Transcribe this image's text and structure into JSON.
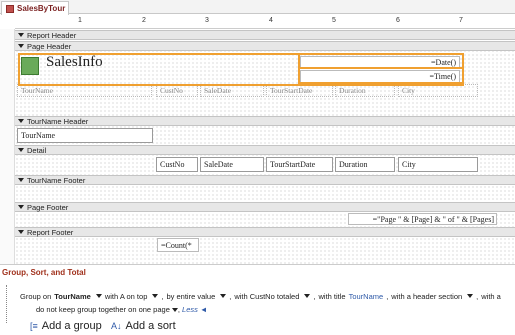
{
  "tab": {
    "title": "SalesByTour"
  },
  "ruler": {
    "marks": [
      "1",
      "2",
      "3",
      "4",
      "5",
      "6",
      "7"
    ]
  },
  "sections": {
    "report_header": "Report Header",
    "page_header": "Page Header",
    "group_header": "TourName Header",
    "detail": "Detail",
    "group_footer": "TourName Footer",
    "page_footer": "Page Footer",
    "report_footer": "Report Footer"
  },
  "page_header": {
    "title": "SalesInfo",
    "date_expr": "=Date()",
    "time_expr": "=Time()",
    "column_labels": [
      "TourName",
      "CustNo",
      "SaleDate",
      "TourStartDate",
      "Duration",
      "City"
    ]
  },
  "group_header": {
    "field": "TourName"
  },
  "detail": {
    "fields": [
      "CustNo",
      "SaleDate",
      "TourStartDate",
      "Duration",
      "City"
    ]
  },
  "page_footer": {
    "page_expr": "=\"Page \" & [Page] & \" of \" & [Pages]"
  },
  "report_footer": {
    "count_expr": "=Count(*"
  },
  "grouping": {
    "panel_title": "Group, Sort, and Total",
    "group_on_prefix": "Group on",
    "group_field": "TourName",
    "order": "with A on top",
    "by": "by entire value",
    "totals": "with CustNo totaled",
    "title_prefix": "with title",
    "title_link": "TourName",
    "header": "with a header section",
    "footer": "with a",
    "keep_together": "do not keep group together on one page",
    "less": "Less ◄",
    "add_group": "Add a group",
    "add_sort": "Add a sort"
  }
}
